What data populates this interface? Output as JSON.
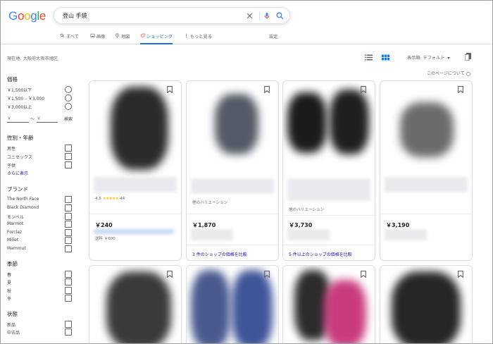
{
  "header": {
    "logo": "Google",
    "logo_colors": [
      "#4285F4",
      "#EA4335",
      "#FBBC05",
      "#4285F4",
      "#34A853",
      "#EA4335"
    ],
    "query": "登山 手袋",
    "icons": [
      "clear-icon",
      "mic-icon",
      "search-icon"
    ]
  },
  "tabs": [
    {
      "label": "すべて",
      "icon": "search-icon"
    },
    {
      "label": "画像",
      "icon": "image-icon"
    },
    {
      "label": "地図",
      "icon": "map-pin-icon"
    },
    {
      "label": "ショッピング",
      "icon": "tag-icon",
      "active": true
    },
    {
      "label": "もっと見る",
      "icon": "more-vert-icon"
    }
  ],
  "settings_label": "設定",
  "subbar": {
    "location": "現在地: 大阪府大阪市旭区",
    "sort_label": "表示順: デフォルト",
    "about_label": "このページについて"
  },
  "filters": {
    "price": {
      "title": "価格",
      "options": [
        "￥1,500以下",
        "￥1,500 – ￥3,000",
        "￥3,000以上"
      ],
      "min_placeholder": "￥",
      "max_placeholder": "￥",
      "separator": "〜",
      "go_label": "検索"
    },
    "gender": {
      "title": "性別・年齢",
      "options": [
        "男性",
        "ユニセックス",
        "子供"
      ],
      "more_label": "さらに表示"
    },
    "brand": {
      "title": "ブランド",
      "options": [
        "The North Face",
        "Black Diamond",
        "モンベル",
        "Marmot",
        "Forclaz",
        "Millet",
        "Mammut"
      ]
    },
    "season": {
      "title": "季節",
      "options": [
        "春",
        "夏",
        "秋",
        "冬"
      ]
    },
    "condition": {
      "title": "状態",
      "options": [
        "新品",
        "中古品"
      ]
    }
  },
  "products": [
    {
      "rating": "4.5",
      "stars": "★★★★★",
      "review_count": "44",
      "price": "￥240",
      "shipping": "送料 ￥600"
    },
    {
      "variation": "他のバリエーション",
      "price": "￥1,870",
      "compare": "3 件のショップの価格を比較"
    },
    {
      "variation": "他のバリエーション",
      "price": "￥3,730",
      "compare": "5 件以上のショップの価格を比較"
    },
    {
      "price": "￥3,190"
    }
  ],
  "colors": {
    "link": "#1a0dab",
    "accent": "#1a73e8",
    "star": "#fbbc04"
  }
}
